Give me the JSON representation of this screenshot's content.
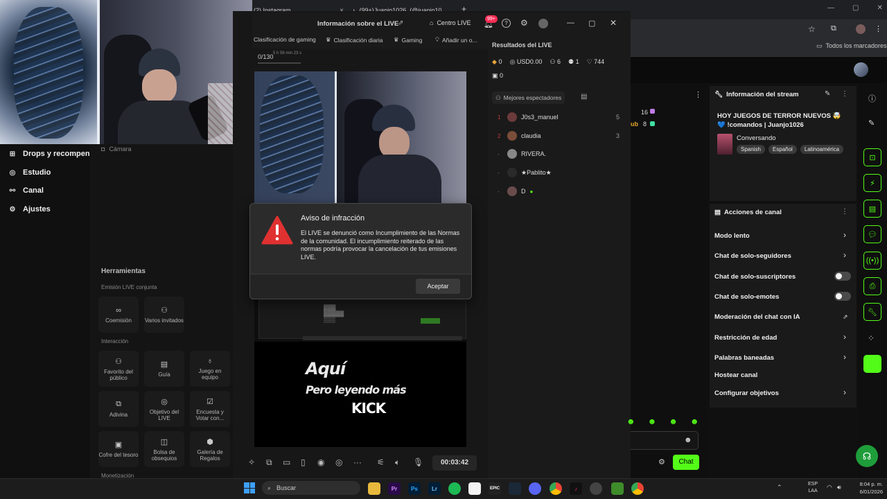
{
  "browser": {
    "tabs": [
      {
        "label": "(2) Instagram"
      },
      {
        "label": "(99+)Juanjo1026_(@juanjo102..."
      }
    ],
    "bookmarks_label": "Todos los marcadores",
    "new_tab": "+",
    "close_x": "×",
    "window_controls": [
      "—",
      "▢",
      "✕"
    ]
  },
  "left_nav": {
    "items": [
      {
        "label": "Drops y recompen"
      },
      {
        "label": "Estudio"
      },
      {
        "label": "Canal"
      },
      {
        "label": "Ajustes"
      }
    ]
  },
  "tools": {
    "camera_label": "Cámara",
    "title": "Herramientas",
    "section_joint": "Emisión LIVE conjunta",
    "section_interaction": "Interacción",
    "section_monetization": "Monetización",
    "cards": [
      {
        "label": "Coemisión"
      },
      {
        "label": "Varios invitados"
      },
      {
        "label": "Favorito del público"
      },
      {
        "label": "Guía"
      },
      {
        "label": "Juego en equipo"
      },
      {
        "label": "Adivina"
      },
      {
        "label": "Objetivo del LIVE"
      },
      {
        "label": "Encuesta y Votar con..."
      },
      {
        "label": "Cofre del tesoro"
      },
      {
        "label": "Bolsa de obsequios"
      },
      {
        "label": "Galería de Regalos"
      }
    ]
  },
  "studio": {
    "title": "Información sobre el LIVE",
    "center_live": "Centro LIVE",
    "notif_badge": "99+",
    "tags": [
      {
        "label": "Clasificación de gaming"
      },
      {
        "label": "Clasificación diaria"
      },
      {
        "label": "Gaming"
      },
      {
        "label": "Añadir un o..."
      }
    ],
    "counter": "0/130",
    "counter_sub": "5 h 56 min 23 s",
    "preview_overlay": {
      "line1": "Aquí",
      "line2": "Pero leyendo más",
      "line3": "KICK"
    },
    "timer": "00:03:42"
  },
  "results": {
    "title": "Resultados del LIVE",
    "stats": [
      "0",
      "USD0.00",
      "6",
      "1",
      "744",
      "0"
    ],
    "top_viewers_label": "Mejores espectadores",
    "viewers": [
      {
        "rank": "1",
        "name": "J0s3_manuel",
        "score": "5"
      },
      {
        "rank": "2",
        "name": "claudia",
        "score": "3"
      },
      {
        "rank": "-",
        "name": "RIVERA.",
        "score": ""
      },
      {
        "rank": "-",
        "name": "★Pablito★",
        "score": ""
      },
      {
        "rank": "-",
        "name": "D",
        "score": ""
      }
    ]
  },
  "kick": {
    "partial_counts": [
      "16",
      "8"
    ],
    "partial_label": "ub",
    "stream_info": {
      "header": "Información del stream",
      "title": "HOY JUEGOS DE TERROR NUEVOS 🤯 💙 !comandos | Juanjo1026",
      "category": "Conversando",
      "tags": [
        "Spanish",
        "Español",
        "Latinoamérica"
      ]
    },
    "channel_actions": {
      "header": "Acciones de canal",
      "items": [
        {
          "label": "Modo lento"
        },
        {
          "label": "Chat de solo-seguidores"
        },
        {
          "label": "Chat de solo-suscriptores"
        },
        {
          "label": "Chat de solo-emotes"
        },
        {
          "label": "Moderación del chat con IA"
        },
        {
          "label": "Restricción de edad"
        },
        {
          "label": "Palabras baneadas"
        },
        {
          "label": "Hostear canal"
        },
        {
          "label": "Configurar objetivos"
        }
      ]
    },
    "chat_button": "Chat"
  },
  "dialog": {
    "title": "Aviso de infracción",
    "body": "El LIVE se denunció como Incumplimiento de las Normas de la comunidad. El incumplimiento reiterado de las normas podría provocar la cancelación de tus emisiones LIVE.",
    "accept": "Aceptar",
    "icon_color": "#e03131"
  },
  "taskbar": {
    "search_placeholder": "Buscar",
    "lang_line1": "ESP",
    "lang_line2": "LAA",
    "time": "8:04 p. m.",
    "date": "6/01/2026",
    "app_labels": [
      "Pr",
      "Ps",
      "Lr",
      "EPIC"
    ]
  },
  "colors": {
    "kick_green": "#53fc18",
    "tiktok_red": "#fe2c55",
    "warning_red": "#e03131"
  }
}
